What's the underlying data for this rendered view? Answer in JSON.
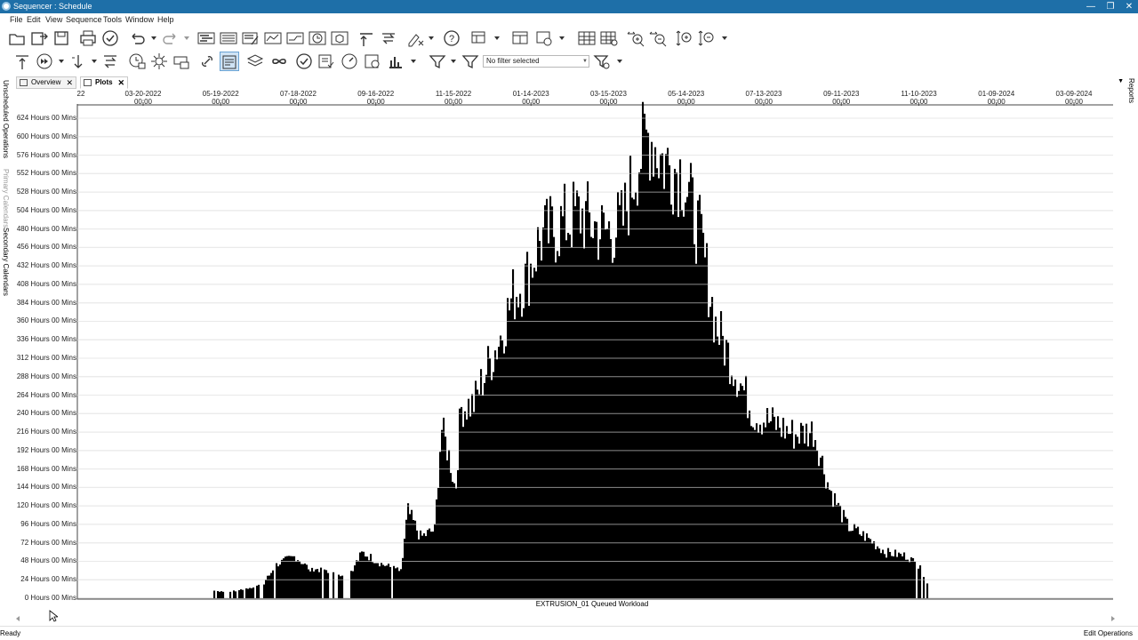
{
  "window": {
    "title": "Sequencer : Schedule"
  },
  "menu": [
    "File",
    "Edit",
    "View",
    "Sequence",
    "Tools",
    "Window",
    "Help"
  ],
  "toolbar": {
    "filter_value": "No filter selected"
  },
  "tabs": [
    {
      "label": "Overview",
      "active": false
    },
    {
      "label": "Plots",
      "active": true
    }
  ],
  "left_panels": [
    "Unscheduled Operations",
    "Primary Calendars",
    "Secondary Calendars"
  ],
  "right_panels": [
    "Reports"
  ],
  "status": {
    "left": "Ready",
    "right": "Edit Operations"
  },
  "colors": {
    "title_bar": "#1e6fa8",
    "bars": "#000000",
    "grid": "#cfcfcf"
  },
  "chart_data": {
    "type": "bar",
    "series_label": "EXTRUSION_01 Queued Workload",
    "x_ticks": [
      {
        "date": "22",
        "time": ""
      },
      {
        "date": "03-20-2022",
        "time": "00:00"
      },
      {
        "date": "05-19-2022",
        "time": "00:00"
      },
      {
        "date": "07-18-2022",
        "time": "00:00"
      },
      {
        "date": "09-16-2022",
        "time": "00:00"
      },
      {
        "date": "11-15-2022",
        "time": "00:00"
      },
      {
        "date": "01-14-2023",
        "time": "00:00"
      },
      {
        "date": "03-15-2023",
        "time": "00:00"
      },
      {
        "date": "05-14-2023",
        "time": "00:00"
      },
      {
        "date": "07-13-2023",
        "time": "00:00"
      },
      {
        "date": "09-11-2023",
        "time": "00:00"
      },
      {
        "date": "11-10-2023",
        "time": "00:00"
      },
      {
        "date": "01-09-2024",
        "time": "00:00"
      },
      {
        "date": "03-09-2024",
        "time": "00:00"
      }
    ],
    "y_ticks": [
      "0 Hours 00 Mins",
      "24 Hours 00 Mins",
      "48 Hours 00 Mins",
      "72 Hours 00 Mins",
      "96 Hours 00 Mins",
      "120 Hours 00 Mins",
      "144 Hours 00 Mins",
      "168 Hours 00 Mins",
      "192 Hours 00 Mins",
      "216 Hours 00 Mins",
      "240 Hours 00 Mins",
      "264 Hours 00 Mins",
      "288 Hours 00 Mins",
      "312 Hours 00 Mins",
      "336 Hours 00 Mins",
      "360 Hours 00 Mins",
      "384 Hours 00 Mins",
      "408 Hours 00 Mins",
      "432 Hours 00 Mins",
      "456 Hours 00 Mins",
      "480 Hours 00 Mins",
      "504 Hours 00 Mins",
      "528 Hours 00 Mins",
      "552 Hours 00 Mins",
      "576 Hours 00 Mins",
      "600 Hours 00 Mins",
      "624 Hours 00 Mins"
    ],
    "y_range_hours": [
      0,
      624
    ],
    "grid": true,
    "envelope": [
      [
        "05-13-2022",
        10
      ],
      [
        "05-25-2022",
        8
      ],
      [
        "06-05-2022",
        12
      ],
      [
        "06-20-2022",
        18
      ],
      [
        "07-01-2022",
        45
      ],
      [
        "07-15-2022",
        55
      ],
      [
        "07-25-2022",
        40
      ],
      [
        "08-10-2022",
        35
      ],
      [
        "08-25-2022",
        30
      ],
      [
        "09-05-2022",
        60
      ],
      [
        "09-20-2022",
        45
      ],
      [
        "10-05-2022",
        35
      ],
      [
        "10-10-2022",
        115
      ],
      [
        "10-20-2022",
        80
      ],
      [
        "10-31-2022",
        90
      ],
      [
        "11-05-2022",
        225
      ],
      [
        "11-12-2022",
        180
      ],
      [
        "11-16-2022",
        140
      ],
      [
        "11-20-2022",
        250
      ],
      [
        "11-30-2022",
        255
      ],
      [
        "12-10-2022",
        300
      ],
      [
        "12-20-2022",
        340
      ],
      [
        "12-31-2022",
        400
      ],
      [
        "01-10-2023",
        420
      ],
      [
        "01-20-2023",
        470
      ],
      [
        "02-05-2023",
        490
      ],
      [
        "02-20-2023",
        505
      ],
      [
        "03-10-2023",
        480
      ],
      [
        "03-25-2023",
        490
      ],
      [
        "04-05-2023",
        570
      ],
      [
        "04-15-2023",
        610
      ],
      [
        "04-25-2023",
        575
      ],
      [
        "05-10-2023",
        560
      ],
      [
        "05-25-2023",
        470
      ],
      [
        "06-05-2023",
        360
      ],
      [
        "06-20-2023",
        300
      ],
      [
        "07-05-2023",
        240
      ],
      [
        "07-20-2023",
        230
      ],
      [
        "08-05-2023",
        215
      ],
      [
        "08-20-2023",
        220
      ],
      [
        "09-01-2023",
        145
      ],
      [
        "09-15-2023",
        95
      ],
      [
        "09-30-2023",
        80
      ],
      [
        "10-15-2023",
        60
      ],
      [
        "11-01-2023",
        55
      ],
      [
        "11-10-2023",
        40
      ],
      [
        "11-16-2023",
        20
      ]
    ]
  }
}
